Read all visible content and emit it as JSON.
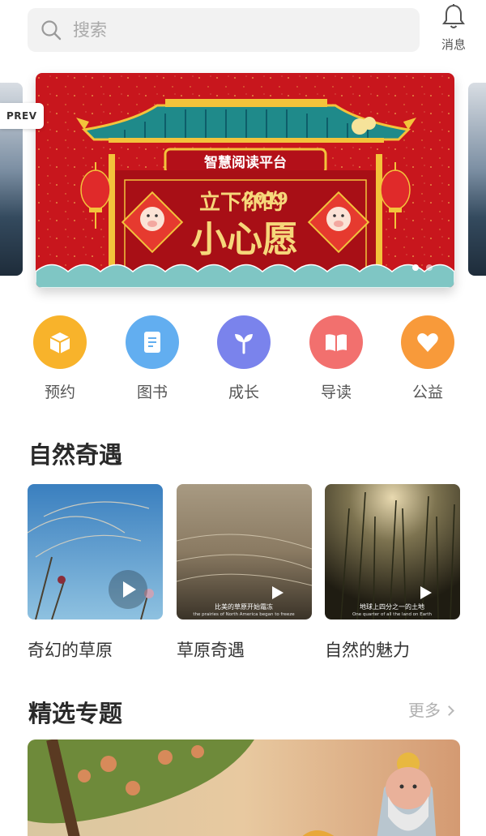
{
  "header": {
    "search_placeholder": "搜索",
    "message_label": "消息"
  },
  "banner": {
    "prev_label": "PREV",
    "platform_title": "智慧阅读平台",
    "year": "2019",
    "wish_line1": "立下你的",
    "wish_line2": "小心愿",
    "active_slide": 1,
    "slide_count": 2
  },
  "categories": [
    {
      "label": "预约",
      "color": "#f8b32b",
      "icon": "box-icon"
    },
    {
      "label": "图书",
      "color": "#62aef0",
      "icon": "book-page-icon"
    },
    {
      "label": "成长",
      "color": "#7a83ec",
      "icon": "sprout-icon"
    },
    {
      "label": "导读",
      "color": "#f2706e",
      "icon": "open-book-icon"
    },
    {
      "label": "公益",
      "color": "#f89a3a",
      "icon": "heart-icon"
    }
  ],
  "nature": {
    "title": "自然奇遇",
    "videos": [
      {
        "title": "奇幻的草原",
        "subtitle_cn": "",
        "subtitle_en": ""
      },
      {
        "title": "草原奇遇",
        "subtitle_cn": "比美的草原开始霜冻",
        "subtitle_en": "the prairies of North America began to freeze"
      },
      {
        "title": "自然的魅力",
        "subtitle_cn": "地球上四分之一的土地",
        "subtitle_en": "One quarter of all the land on Earth"
      }
    ]
  },
  "featured": {
    "title": "精选专题",
    "more_label": "更多"
  },
  "colors": {
    "banner_red": "#c8161d",
    "gold": "#f3c33b",
    "search_bg": "#f2f2f2"
  }
}
